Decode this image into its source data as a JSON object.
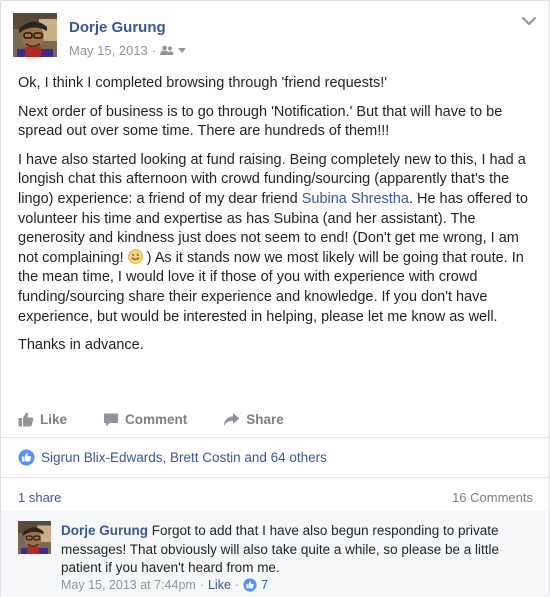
{
  "post": {
    "author": "Dorje Gurung",
    "date": "May 15, 2013",
    "separator": "·",
    "paragraphs": {
      "p1": "Ok, I think I completed browsing through 'friend requests!'",
      "p2": "Next order of business is to go through 'Notification.' But that will have to be spread out over some time. There are hundreds of them!!!",
      "p3_a": "I have also started looking at fund raising. Being completely new to this, I had a longish chat this afternoon with crowd funding/sourcing (apparently that's the lingo) experience: a friend of my dear friend ",
      "p3_link": "Subina Shrestha",
      "p3_b": ". He has offered to volunteer his time and expertise as has Subina (and her assistant). The generosity and kindness just does not seem to end! (Don't get me wrong, I am not complaining! ",
      "p3_c": " ) As it stands now we most likely will be going that route. In the mean time, I would love it if those of you with experience with crowd funding/sourcing share their experience and knowledge. If you don't have experience, but would be interested in helping, please let me know as well.",
      "p4": "Thanks in advance."
    }
  },
  "actions": {
    "like": "Like",
    "comment": "Comment",
    "share": "Share"
  },
  "reactions": {
    "text": "Sigrun Blix-Edwards, Brett Costin and 64 others"
  },
  "stats": {
    "shares": "1 share",
    "comments": "16 Comments"
  },
  "comment": {
    "author": "Dorje Gurung",
    "text": " Forgot to add that I have also begun responding to private messages! That obviously will also take quite a while, so please be a little patient if you haven't heard from me.",
    "date": "May 15, 2013 at 7:44pm",
    "separator": "·",
    "like": "Like",
    "like_count": "7"
  },
  "colors": {
    "brand_blue": "#365899",
    "text": "#1d2129",
    "muted": "#90949c",
    "like_badge": "#5890ff"
  },
  "icons": {
    "menu": "chevron-down-icon",
    "audience": "friends-icon",
    "like": "thumbs-up-icon",
    "comment": "speech-bubble-icon",
    "share": "share-arrow-icon",
    "reaction": "like-badge-icon",
    "emoticon": "smile-emoticon-icon"
  }
}
